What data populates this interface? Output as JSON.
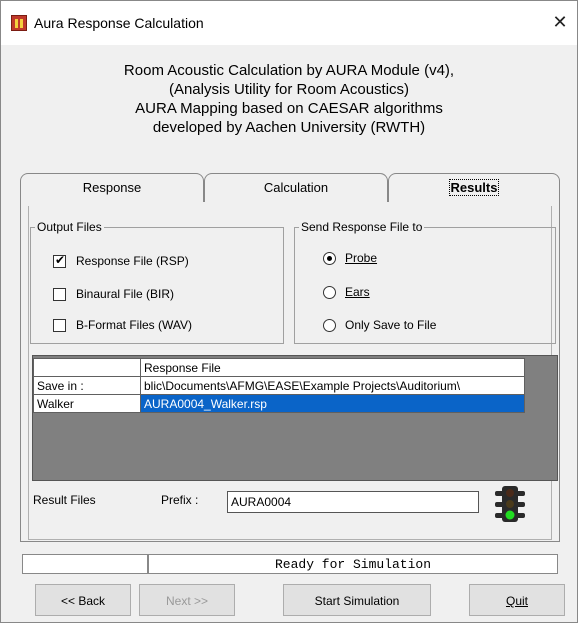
{
  "window": {
    "title": "Aura Response Calculation",
    "close_glyph": "✕",
    "app_icon": "aura-app-icon"
  },
  "header": {
    "lines": [
      "Room Acoustic Calculation by AURA Module (v4),",
      "(Analysis Utility for Room Acoustics)",
      "AURA Mapping based on CAESAR algorithms",
      "developed by Aachen University (RWTH)"
    ]
  },
  "tabs": [
    {
      "label": "Response",
      "active": false
    },
    {
      "label": "Calculation",
      "active": false
    },
    {
      "label": "Results",
      "active": true
    }
  ],
  "output_files": {
    "legend": "Output Files",
    "items": [
      {
        "label": "Response File (RSP)",
        "checked": true
      },
      {
        "label": "Binaural File (BIR)",
        "checked": false
      },
      {
        "label": "B-Format Files (WAV)",
        "checked": false
      }
    ]
  },
  "send_response": {
    "legend": "Send Response File to",
    "options": [
      {
        "label": "Probe",
        "selected": true
      },
      {
        "label": "Ears",
        "selected": false
      },
      {
        "label": "Only Save to File",
        "selected": false
      }
    ]
  },
  "grid": {
    "header": [
      "",
      "Response File"
    ],
    "rows": [
      [
        "Save in :",
        "blic\\Documents\\AFMG\\EASE\\Example Projects\\Auditorium\\"
      ],
      [
        "Walker",
        "AURA0004_Walker.rsp"
      ]
    ]
  },
  "result_files": {
    "label": "Result Files",
    "prefix_label": "Prefix :",
    "prefix_value": "AURA0004",
    "status_icon": "traffic-light-icon"
  },
  "status": {
    "left": "",
    "message": "Ready for Simulation"
  },
  "buttons": {
    "back": "<< Back",
    "next": "Next >>",
    "start": "Start Simulation",
    "quit": "Quit"
  },
  "colors": {
    "selection": "#0a64c8",
    "traffic_green": "#22dd22",
    "traffic_off": "#4a2a1a"
  }
}
